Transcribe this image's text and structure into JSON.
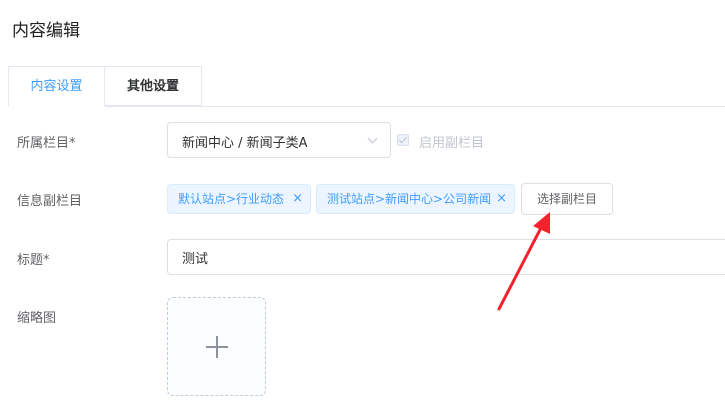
{
  "page": {
    "title": "内容编辑"
  },
  "tabs": [
    {
      "label": "内容设置",
      "active": true
    },
    {
      "label": "其他设置",
      "active": false
    }
  ],
  "form": {
    "column": {
      "label": "所属栏目*",
      "value": "新闻中心 / 新闻子类A",
      "enable_sub_label": "启用副栏目"
    },
    "sub_column": {
      "label": "信息副栏目",
      "tags": [
        {
          "text": "默认站点>行业动态",
          "close": "×"
        },
        {
          "text": "测试站点>新闻中心>公司新闻",
          "close": "×"
        }
      ],
      "choose_button": "选择副栏目"
    },
    "title": {
      "label": "标题*",
      "value": "测试"
    },
    "thumbnail": {
      "label": "缩略图"
    }
  },
  "colors": {
    "accent": "#409eff",
    "annotation_arrow": "#f5222d",
    "tag_bg": "#ecf5ff"
  },
  "icons": [
    "chevron-down-icon",
    "checkbox-icon",
    "close-icon",
    "plus-icon",
    "arrow-annotation"
  ]
}
